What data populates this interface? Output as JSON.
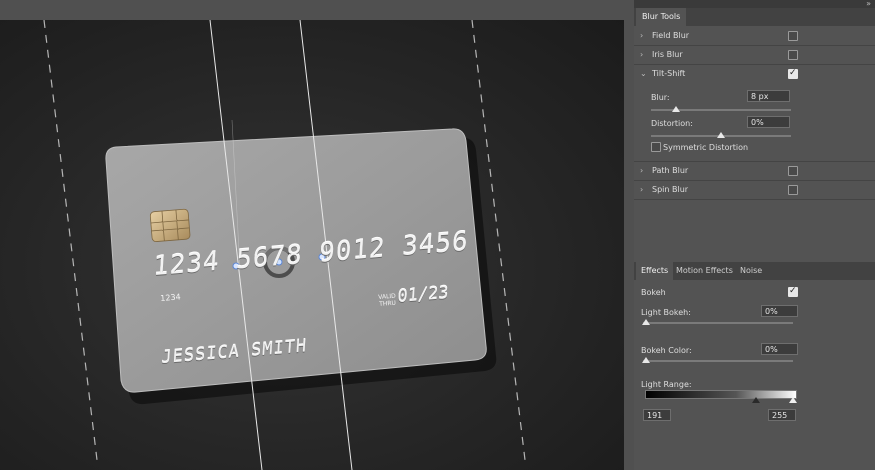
{
  "card": {
    "number_display": "1234 5678 9012 3456",
    "number_small": "1234",
    "valid_line1": "VALID",
    "valid_line2": "THRU",
    "expiry": "01/23",
    "holder": "JESSICA SMITH"
  },
  "panel": {
    "collapse_icon": "double-chevron-right-icon",
    "blur_tools_tab": "Blur Tools",
    "blur_tools": [
      {
        "label": "Field Blur",
        "expanded": false,
        "checked": false
      },
      {
        "label": "Iris Blur",
        "expanded": false,
        "checked": false
      },
      {
        "label": "Tilt-Shift",
        "expanded": true,
        "checked": true
      },
      {
        "label": "Path Blur",
        "expanded": false,
        "checked": false
      },
      {
        "label": "Spin Blur",
        "expanded": false,
        "checked": false
      }
    ],
    "tilt_shift": {
      "blur_label": "Blur:",
      "blur_value": "8 px",
      "distortion_label": "Distortion:",
      "distortion_value": "0%",
      "symmetric_label": "Symmetric Distortion",
      "symmetric_checked": false
    },
    "effects_tabs": [
      "Effects",
      "Motion Effects",
      "Noise"
    ],
    "effects_active_tab": "Effects",
    "effects": {
      "bokeh_label": "Bokeh",
      "bokeh_checked": true,
      "light_bokeh_label": "Light Bokeh:",
      "light_bokeh_value": "0%",
      "bokeh_color_label": "Bokeh Color:",
      "bokeh_color_value": "0%",
      "light_range_label": "Light Range:",
      "light_range_low": "191",
      "light_range_high": "255"
    }
  },
  "colors": {
    "panel_bg": "#535353",
    "tab_bar": "#424242",
    "canvas_bg": "#262626",
    "card": "#9a9a9a"
  }
}
